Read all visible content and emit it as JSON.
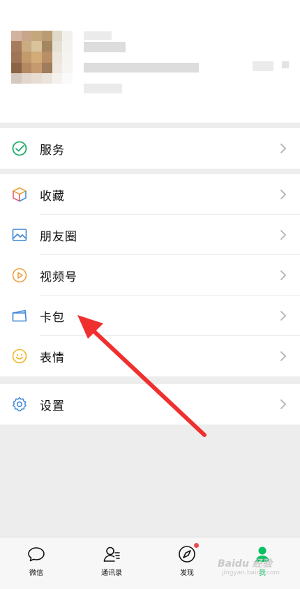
{
  "menu": {
    "services": {
      "label": "服务",
      "icon": "services-check-icon"
    },
    "group2": [
      {
        "key": "favorites",
        "label": "收藏",
        "icon": "cube-icon"
      },
      {
        "key": "moments",
        "label": "朋友圈",
        "icon": "image-icon"
      },
      {
        "key": "channels",
        "label": "视频号",
        "icon": "play-circle-icon"
      },
      {
        "key": "cards",
        "label": "卡包",
        "icon": "card-icon"
      },
      {
        "key": "stickers",
        "label": "表情",
        "icon": "smile-icon"
      }
    ],
    "settings": {
      "label": "设置",
      "icon": "gear-icon"
    }
  },
  "tabbar": {
    "chats": "微信",
    "contacts": "通讯录",
    "discover": "发现",
    "me": "我"
  },
  "watermark": {
    "text": "Baidu 经验",
    "sub": "jingyan.baidu.com"
  },
  "colors": {
    "accent": "#07c160",
    "annotation_arrow": "#f0302f",
    "badge": "#f04a4a"
  }
}
